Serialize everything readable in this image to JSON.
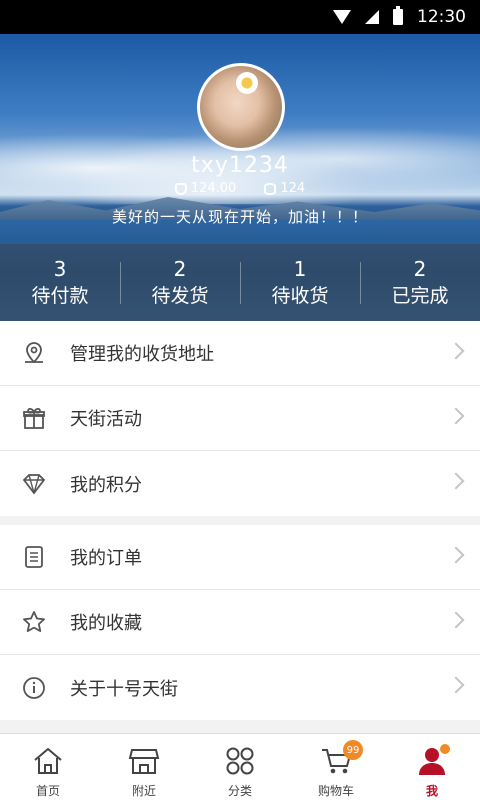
{
  "status_bar": {
    "time": "12:30"
  },
  "profile": {
    "username": "txy1234",
    "balance": "124.00",
    "points": "124",
    "motto": "美好的一天从现在开始，加油！！！"
  },
  "orders": [
    {
      "count": "3",
      "label": "待付款"
    },
    {
      "count": "2",
      "label": "待发货"
    },
    {
      "count": "1",
      "label": "待收货"
    },
    {
      "count": "2",
      "label": "已完成"
    }
  ],
  "menu_group1": [
    {
      "label": "管理我的收货地址",
      "icon": "location-pin-icon"
    },
    {
      "label": "天街活动",
      "icon": "gift-icon"
    },
    {
      "label": "我的积分",
      "icon": "diamond-icon"
    }
  ],
  "menu_group2": [
    {
      "label": "我的订单",
      "icon": "clipboard-icon"
    },
    {
      "label": "我的收藏",
      "icon": "star-icon"
    },
    {
      "label": "关于十号天街",
      "icon": "info-icon"
    }
  ],
  "tabbar": {
    "tabs": [
      {
        "label": "首页",
        "icon": "home-icon"
      },
      {
        "label": "附近",
        "icon": "store-icon"
      },
      {
        "label": "分类",
        "icon": "grid-icon"
      },
      {
        "label": "购物车",
        "icon": "cart-icon"
      },
      {
        "label": "我",
        "icon": "user-icon"
      }
    ],
    "cart_badge": "99",
    "active_color": "#b5122a",
    "badge_color": "#f08a24"
  }
}
